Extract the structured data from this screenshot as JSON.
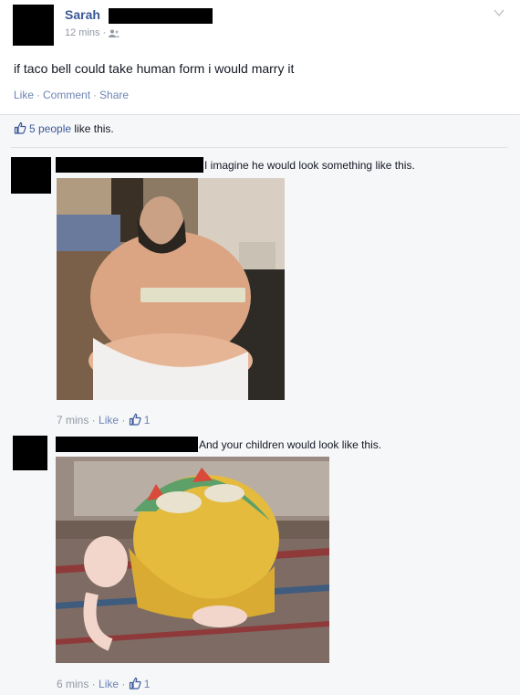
{
  "post": {
    "author": "Sarah",
    "time": "12 mins",
    "audience_icon": "friends-icon",
    "text": "if taco bell could take human form i would marry it",
    "actions": {
      "like": "Like",
      "comment": "Comment",
      "share": "Share"
    },
    "likes_count": "5 people",
    "likes_suffix": "like this."
  },
  "comments": [
    {
      "text": "I imagine he would look something like this.",
      "time": "7 mins",
      "like": "Like",
      "like_count": "1"
    },
    {
      "text": "And your children would look like this.",
      "time": "6 mins",
      "like": "Like",
      "like_count": "1"
    }
  ],
  "colors": {
    "link": "#3b5998",
    "muted": "#9197a3",
    "action": "#6d84b4",
    "feedback_bg": "#f6f7f9"
  }
}
